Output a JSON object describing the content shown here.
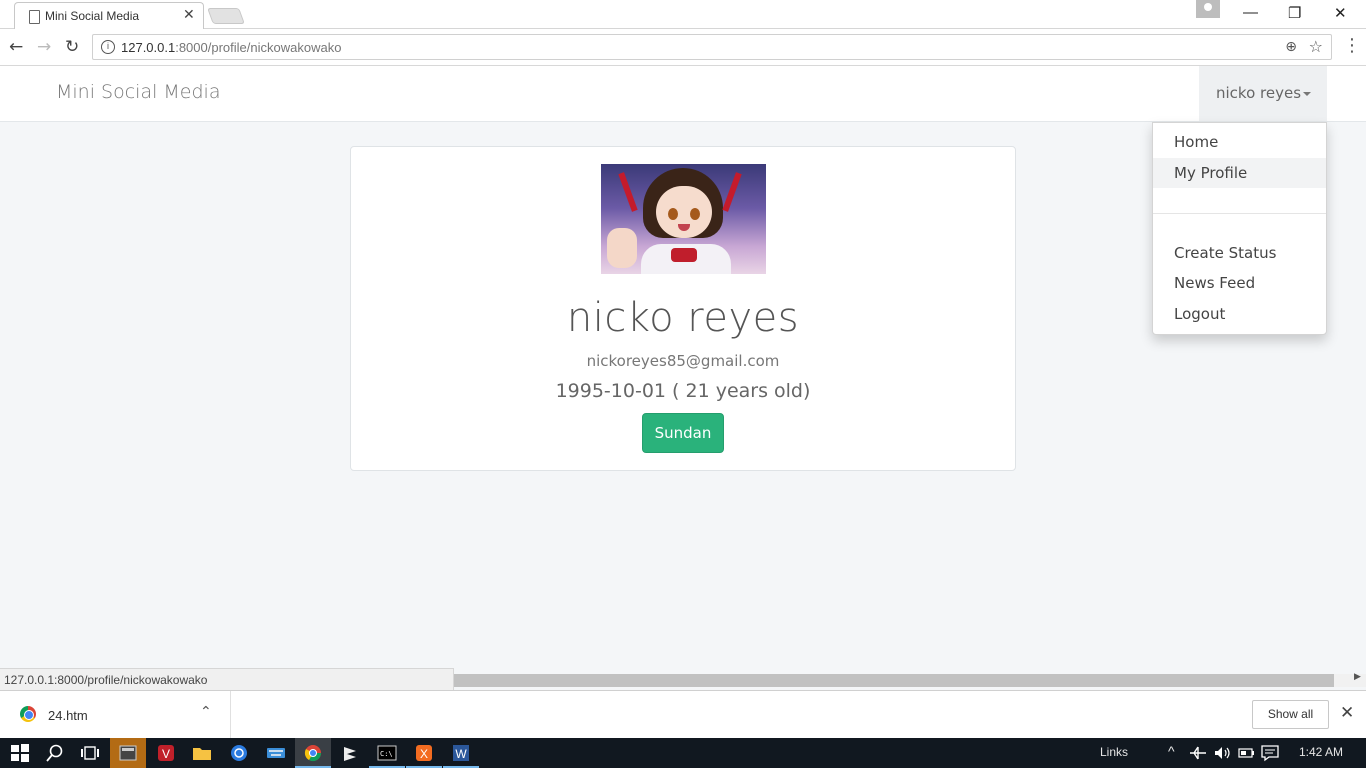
{
  "browser": {
    "tab_title": "Mini Social Media",
    "tab_close": "✕",
    "url_host": "127.0.0.1",
    "url_path": ":8000/profile/nickowakowako",
    "status_url": "127.0.0.1:8000/profile/nickowakowako",
    "info_icon": "i",
    "zoom_icon": "⊕",
    "star_icon": "☆",
    "menu_icon": "⋮",
    "back_icon": "←",
    "forward_icon": "→",
    "reload_icon": "↻",
    "minimize_icon": "—",
    "restore_icon": "❐",
    "close_icon": "✕"
  },
  "navbar": {
    "brand": "Mini Social Media",
    "user_name": "nicko reyes"
  },
  "dropdown": {
    "items": [
      {
        "label": "Home"
      },
      {
        "label": "My Profile"
      },
      {
        "label": "Create Status"
      },
      {
        "label": "News Feed"
      },
      {
        "label": "Logout"
      }
    ],
    "active_index": 1
  },
  "profile": {
    "name": "nicko reyes",
    "email": "nickoreyes85@gmail.com",
    "birth": "1995-10-01 ( 21 years old)",
    "button_label": "Sundan"
  },
  "downloads": {
    "file_name": "24.htm",
    "chevron": "⌃",
    "show_all": "Show all",
    "close": "✕"
  },
  "taskbar": {
    "links_label": "Links",
    "clock": "1:42 AM",
    "tray_up": "^"
  },
  "colors": {
    "accent_green": "#2ab27b",
    "page_bg": "#f4f6f8",
    "taskbar_bg": "#111820"
  }
}
